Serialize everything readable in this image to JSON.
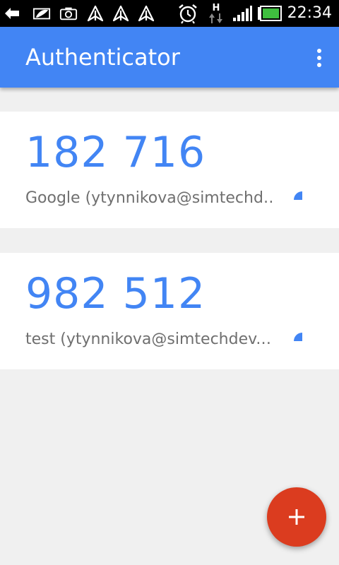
{
  "status_bar": {
    "time": "22:34",
    "network_label": "H",
    "icons": [
      "back-notification-icon",
      "image-notification-icon",
      "camera-notification-icon",
      "upload-notification-icon",
      "upload-notification-icon",
      "upload-notification-icon",
      "alarm-icon",
      "data-transfer-icon",
      "signal-icon",
      "battery-icon"
    ]
  },
  "app_bar": {
    "title": "Authenticator",
    "menu_icon": "overflow-menu-icon",
    "color": "#4285f4"
  },
  "accounts": [
    {
      "code": "182 716",
      "name": "Google (ytynnikova@simtechd…"
    },
    {
      "code": "982 512",
      "name": "test (ytynnikova@simtechdev.…"
    }
  ],
  "fab": {
    "icon": "plus-icon",
    "color": "#db3c1f"
  },
  "colors": {
    "accent": "#4285f4",
    "background": "#f0f0f0",
    "account_text": "#6f6f6f"
  }
}
